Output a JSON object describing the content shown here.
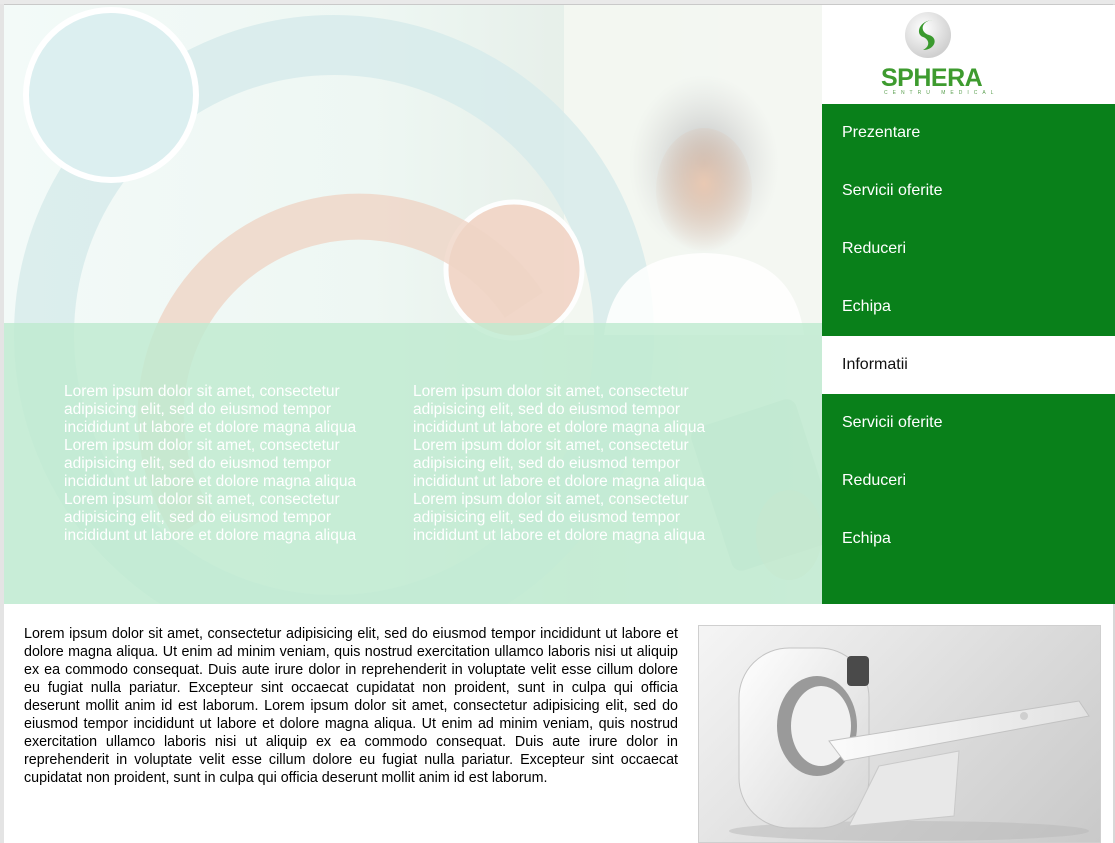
{
  "logo": {
    "name": "SPHERA",
    "tagline": "CENTRU MEDICAL"
  },
  "menu": {
    "items": [
      {
        "label": "Prezentare",
        "active": false
      },
      {
        "label": "Servicii oferite",
        "active": false
      },
      {
        "label": "Reduceri",
        "active": false
      },
      {
        "label": "Echipa",
        "active": false
      },
      {
        "label": "Informatii",
        "active": true
      },
      {
        "label": "Servicii oferite",
        "active": false
      },
      {
        "label": "Reduceri",
        "active": false
      },
      {
        "label": "Echipa",
        "active": false
      }
    ]
  },
  "hero": {
    "col1": "Lorem ipsum dolor sit amet, consectetur\nadipisicing elit, sed do eiusmod tempor\nincididunt ut labore et dolore magna aliqua\nLorem ipsum dolor sit amet, consectetur\nadipisicing elit, sed do eiusmod tempor\nincididunt ut labore et dolore magna aliqua\nLorem ipsum dolor sit amet, consectetur\nadipisicing elit, sed do eiusmod tempor\nincididunt ut labore et dolore magna aliqua",
    "col2": "Lorem ipsum dolor sit amet, consectetur\nadipisicing elit, sed do eiusmod tempor\nincididunt ut labore et dolore magna aliqua\nLorem ipsum dolor sit amet, consectetur\nadipisicing elit, sed do eiusmod tempor\nincididunt ut labore et dolore magna aliqua\nLorem ipsum dolor sit amet, consectetur\nadipisicing elit, sed do eiusmod tempor\nincididunt ut labore et dolore magna aliqua"
  },
  "content": {
    "paragraph": "Lorem ipsum dolor sit amet, consectetur adipisicing elit, sed do eiusmod tempor incididunt ut labore et dolore magna aliqua. Ut enim ad minim veniam, quis nostrud exercitation ullamco laboris nisi ut aliquip ex ea commodo consequat. Duis aute irure dolor in reprehenderit in voluptate velit esse cillum dolore eu fugiat nulla pariatur. Excepteur sint occaecat cupidatat non proident, sunt in culpa qui officia deserunt mollit anim id est laborum. Lorem ipsum dolor sit amet, consectetur adipisicing elit, sed do eiusmod tempor incididunt ut labore et dolore magna aliqua. Ut enim ad minim veniam, quis nostrud exercitation ullamco laboris nisi ut aliquip ex ea commodo consequat. Duis aute irure dolor in reprehenderit in voluptate velit esse cillum dolore eu fugiat nulla pariatur. Excepteur sint occaecat cupidatat non proident, sunt in culpa qui officia deserunt mollit anim id est laborum."
  },
  "colors": {
    "menu_bg": "#09801a",
    "overlay": "#bfead0",
    "logo_green": "#3e9b2f"
  },
  "icons": [
    "sphera-logo-icon",
    "ct-scanner-image",
    "doctor-photo"
  ]
}
